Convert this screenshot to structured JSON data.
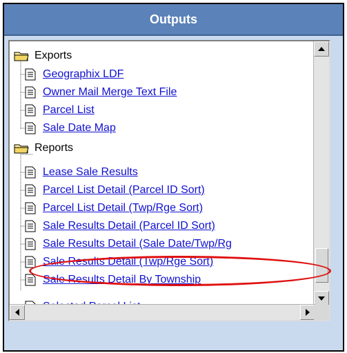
{
  "panel": {
    "title": "Outputs"
  },
  "tree": {
    "exports_label": "Exports",
    "exports": [
      "Geographix LDF",
      "Owner Mail Merge Text File",
      "Parcel List",
      "Sale Date Map"
    ],
    "reports_label": "Reports",
    "reports": [
      "Lease Sale Results",
      "Parcel List Detail (Parcel ID Sort)",
      "Parcel List Detail (Twp/Rge Sort)",
      "Sale Results Detail (Parcel ID Sort)",
      "Sale Results Detail (Sale Date/Twp/Rg",
      "Sale Results Detail (Twp/Rge Sort)",
      "Sale Results Detail By Township",
      "Selected Parcel List"
    ]
  },
  "colors": {
    "title_bar": "#5c83b9",
    "link": "#1010d0",
    "highlight": "#e01010"
  },
  "icons": [
    "folder-icon",
    "document-icon",
    "scroll-up-icon",
    "scroll-down-icon",
    "scroll-left-icon",
    "scroll-right-icon"
  ]
}
